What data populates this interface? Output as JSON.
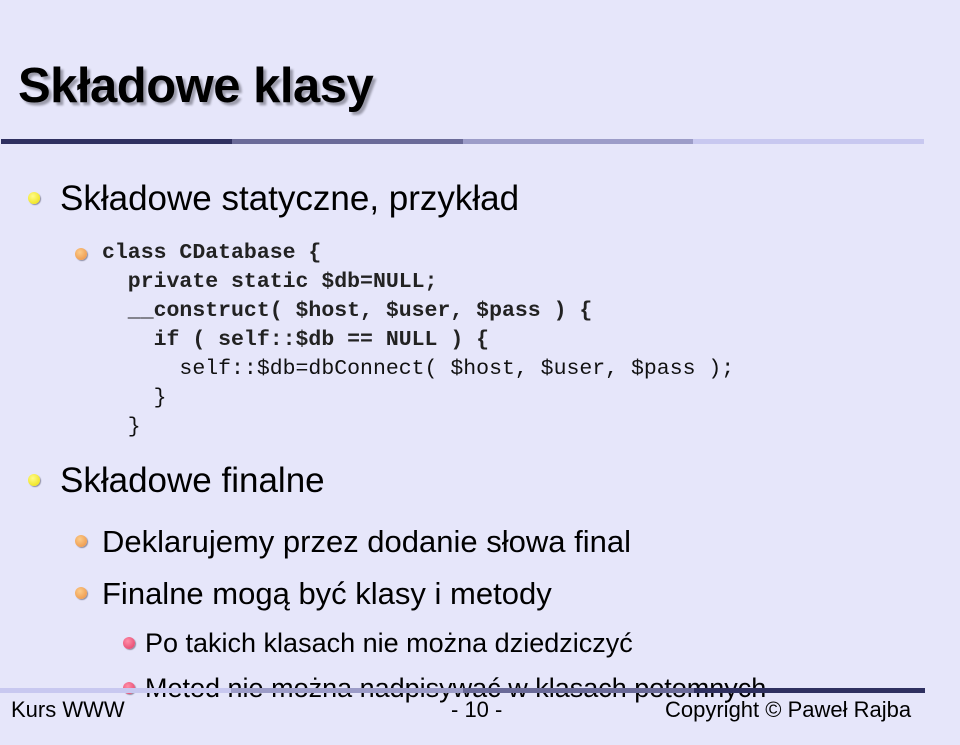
{
  "slide": {
    "title": "Składowe klasy",
    "theme_colors": {
      "background": "#e6e6fa",
      "divider_segments_dark_to_light": [
        "#2f3060",
        "#6a6a98",
        "#9c9cc8",
        "#c8c8f0"
      ],
      "bullet_level1": "#f1e62a",
      "bullet_level2": "#f0a055",
      "bullet_level3": "#ea5378"
    },
    "sections": [
      {
        "heading": "Składowe statyczne, przykład",
        "code_lines": [
          "class CDatabase {",
          "  private static $db=NULL;",
          "  __construct( $host, $user, $pass ) {",
          "    if ( self::$db == NULL ) {",
          "      self::$db=dbConnect( $host, $user, $pass );",
          "    }",
          "  }"
        ]
      },
      {
        "heading": "Składowe finalne",
        "items": [
          {
            "text": "Deklarujemy przez dodanie słowa final"
          },
          {
            "text": "Finalne mogą być klasy i metody",
            "subitems": [
              "Po takich klasach nie można dziedziczyć",
              "Metod nie można nadpisywać w klasach potomnych"
            ]
          }
        ]
      }
    ],
    "footer": {
      "left": "Kurs WWW",
      "center": "- 10 -",
      "right": "Copyright © Paweł Rajba"
    }
  }
}
